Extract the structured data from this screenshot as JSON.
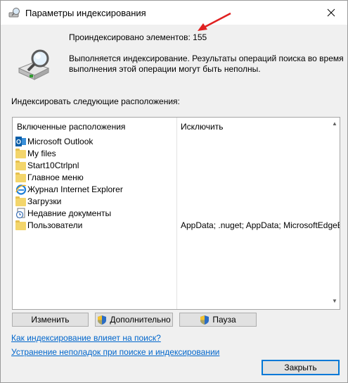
{
  "window": {
    "title": "Параметры индексирования"
  },
  "summary": {
    "count_label": "Проиндексировано элементов:",
    "count_value": "155",
    "status": "Выполняется индексирование. Результаты операций поиска во время выполнения этой операции могут быть неполны."
  },
  "locations": {
    "section_label": "Индексировать следующие расположения:",
    "headers": {
      "included": "Включенные расположения",
      "exclude": "Исключить"
    },
    "rows": [
      {
        "name": "Microsoft Outlook",
        "icon": "outlook-icon",
        "exclude": ""
      },
      {
        "name": "My files",
        "icon": "folder-icon",
        "exclude": ""
      },
      {
        "name": "Start10Ctrlpnl",
        "icon": "folder-icon",
        "exclude": ""
      },
      {
        "name": "Главное меню",
        "icon": "folder-icon",
        "exclude": ""
      },
      {
        "name": "Журнал Internet Explorer",
        "icon": "internet-explorer-icon",
        "exclude": ""
      },
      {
        "name": "Загрузки",
        "icon": "folder-icon",
        "exclude": ""
      },
      {
        "name": "Недавние документы",
        "icon": "recent-documents-icon",
        "exclude": ""
      },
      {
        "name": "Пользователи",
        "icon": "folder-icon",
        "exclude": "AppData; .nuget; AppData; MicrosoftEdgeBack"
      }
    ]
  },
  "buttons": {
    "modify": "Изменить",
    "advanced": "Дополнительно",
    "pause": "Пауза",
    "close": "Закрыть"
  },
  "links": {
    "how_indexing_affects": "Как индексирование влияет на поиск?",
    "troubleshoot": "Устранение неполадок при поиске и индексировании"
  },
  "colors": {
    "accent": "#0078d7",
    "link": "#0066cc",
    "annotation_arrow": "#e02020"
  }
}
